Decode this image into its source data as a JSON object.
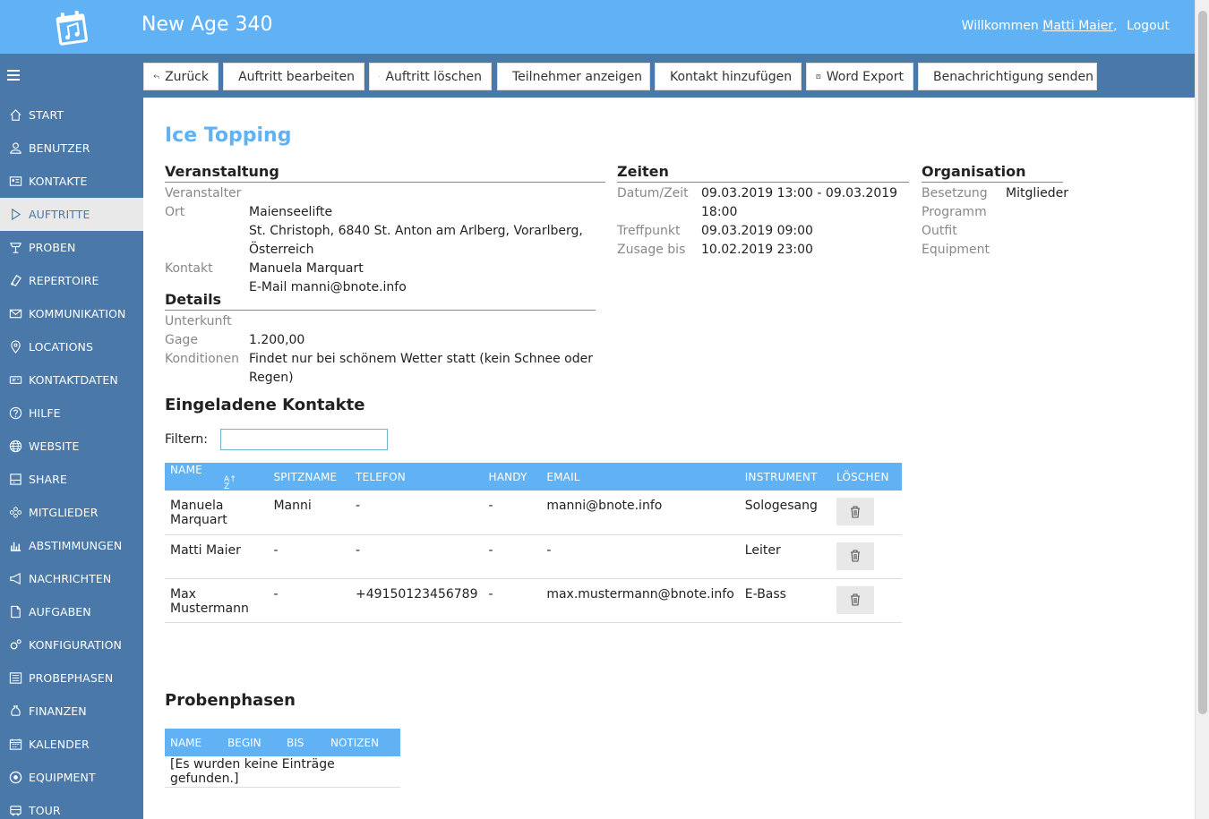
{
  "header": {
    "app_title": "New Age 340",
    "welcome_prefix": "Willkommen",
    "user_name": "Matti Maier",
    "comma": ",",
    "logout": "Logout"
  },
  "sidebar": {
    "items": [
      {
        "label": "START",
        "icon": "home-icon"
      },
      {
        "label": "BENUTZER",
        "icon": "user-icon"
      },
      {
        "label": "KONTAKTE",
        "icon": "address-card-icon"
      },
      {
        "label": "AUFTRITTE",
        "icon": "play-icon",
        "active": true
      },
      {
        "label": "PROBEN",
        "icon": "music-stand-icon"
      },
      {
        "label": "REPERTOIRE",
        "icon": "sheet-music-icon"
      },
      {
        "label": "KOMMUNIKATION",
        "icon": "envelope-icon"
      },
      {
        "label": "LOCATIONS",
        "icon": "map-pin-icon"
      },
      {
        "label": "KONTAKTDATEN",
        "icon": "id-card-icon"
      },
      {
        "label": "HILFE",
        "icon": "help-icon"
      },
      {
        "label": "WEBSITE",
        "icon": "globe-icon"
      },
      {
        "label": "SHARE",
        "icon": "share-drive-icon"
      },
      {
        "label": "MITGLIEDER",
        "icon": "group-icon"
      },
      {
        "label": "ABSTIMMUNGEN",
        "icon": "bar-chart-icon"
      },
      {
        "label": "NACHRICHTEN",
        "icon": "megaphone-icon"
      },
      {
        "label": "AUFGABEN",
        "icon": "document-icon"
      },
      {
        "label": "KONFIGURATION",
        "icon": "gears-icon"
      },
      {
        "label": "PROBEPHASEN",
        "icon": "list-icon"
      },
      {
        "label": "FINANZEN",
        "icon": "money-bag-icon"
      },
      {
        "label": "KALENDER",
        "icon": "calendar-icon"
      },
      {
        "label": "EQUIPMENT",
        "icon": "speaker-icon"
      },
      {
        "label": "TOUR",
        "icon": "bus-icon"
      }
    ]
  },
  "toolbar": {
    "back": "Zurück",
    "edit": "Auftritt bearbeiten",
    "delete": "Auftritt löschen",
    "participants": "Teilnehmer anzeigen",
    "add_contact": "Kontakt hinzufügen",
    "word_export": "Word Export",
    "notify": "Benachrichtigung senden"
  },
  "page": {
    "title": "Ice Topping"
  },
  "veranstaltung": {
    "title": "Veranstaltung",
    "rows": [
      {
        "k": "Veranstalter",
        "v": ""
      },
      {
        "k": "Ort",
        "v": "Maienseelifte"
      },
      {
        "k": "",
        "v": "St. Christoph, 6840 St. Anton am Arlberg, Vorarlberg, Österreich"
      },
      {
        "k": "Kontakt",
        "v": "Manuela Marquart"
      },
      {
        "k": "",
        "v": "E-Mail manni@bnote.info"
      }
    ]
  },
  "details": {
    "title": "Details",
    "rows": [
      {
        "k": "Unterkunft",
        "v": ""
      },
      {
        "k": "Gage",
        "v": "1.200,00"
      },
      {
        "k": "Konditionen",
        "v": "Findet nur bei schönem Wetter statt (kein Schnee oder Regen)"
      }
    ]
  },
  "zeiten": {
    "title": "Zeiten",
    "rows": [
      {
        "k": "Datum/Zeit",
        "v": "09.03.2019 13:00 - 09.03.2019 18:00"
      },
      {
        "k": "Treffpunkt",
        "v": "09.03.2019 09:00"
      },
      {
        "k": "Zusage bis",
        "v": "10.02.2019 23:00"
      }
    ]
  },
  "organisation": {
    "title": "Organisation",
    "rows": [
      {
        "k": "Besetzung",
        "v": "Mitglieder"
      },
      {
        "k": "Programm",
        "v": ""
      },
      {
        "k": "Outfit",
        "v": ""
      },
      {
        "k": "Equipment",
        "v": ""
      }
    ]
  },
  "contacts": {
    "title": "Eingeladene Kontakte",
    "filter_label": "Filtern:",
    "filter_value": "",
    "columns": [
      "NAME",
      "SPITZNAME",
      "TELEFON",
      "HANDY",
      "EMAIL",
      "INSTRUMENT",
      "LÖSCHEN"
    ],
    "rows": [
      [
        "Manuela Marquart",
        "Manni",
        "-",
        "-",
        "manni@bnote.info",
        "Sologesang"
      ],
      [
        "Matti Maier",
        "-",
        "-",
        "-",
        "-",
        "Leiter"
      ],
      [
        "Max Mustermann",
        "-",
        "+49150123456789",
        "-",
        "max.mustermann@bnote.info",
        "E-Bass"
      ]
    ]
  },
  "probenphasen": {
    "title": "Probenphasen",
    "columns": [
      "NAME",
      "BEGIN",
      "BIS",
      "NOTIZEN"
    ],
    "empty": "[Es wurden keine Einträge gefunden.]"
  }
}
